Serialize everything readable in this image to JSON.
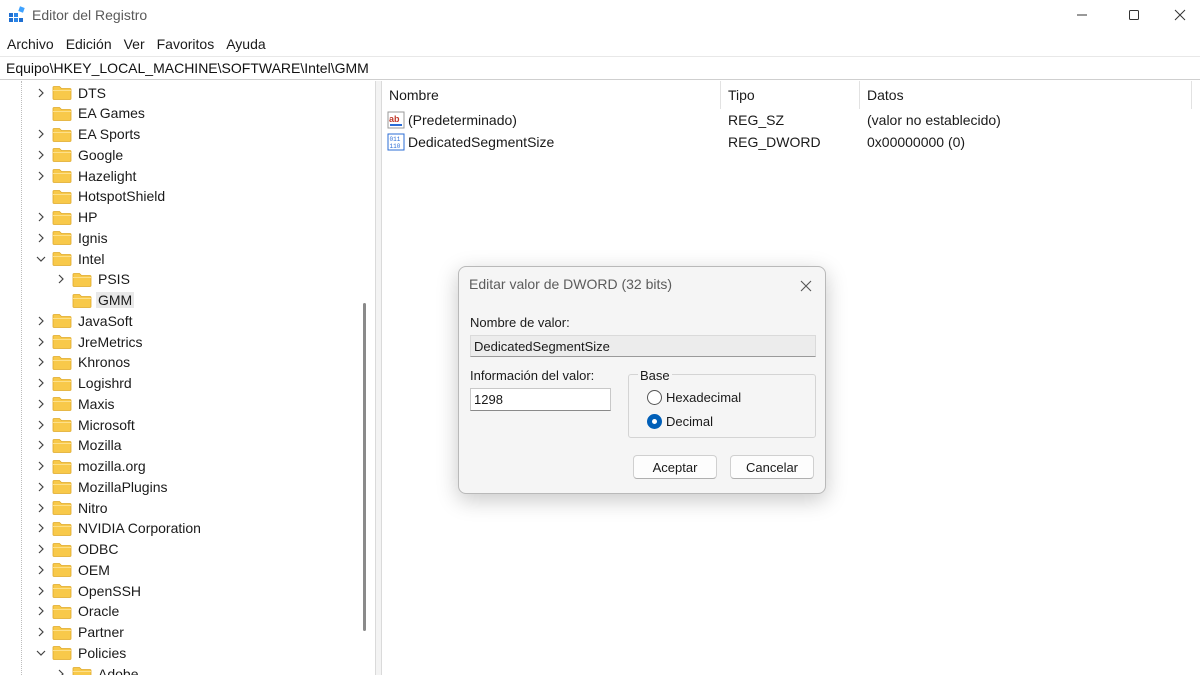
{
  "window": {
    "title": "Editor del Registro"
  },
  "menu": [
    "Archivo",
    "Edición",
    "Ver",
    "Favoritos",
    "Ayuda"
  ],
  "address": "Equipo\\HKEY_LOCAL_MACHINE\\SOFTWARE\\Intel\\GMM",
  "tree": {
    "items": [
      {
        "label": "DTS",
        "level": 0,
        "expander": "collapsed"
      },
      {
        "label": "EA Games",
        "level": 0,
        "expander": "none"
      },
      {
        "label": "EA Sports",
        "level": 0,
        "expander": "collapsed"
      },
      {
        "label": "Google",
        "level": 0,
        "expander": "collapsed"
      },
      {
        "label": "Hazelight",
        "level": 0,
        "expander": "collapsed"
      },
      {
        "label": "HotspotShield",
        "level": 0,
        "expander": "none"
      },
      {
        "label": "HP",
        "level": 0,
        "expander": "collapsed"
      },
      {
        "label": "Ignis",
        "level": 0,
        "expander": "collapsed"
      },
      {
        "label": "Intel",
        "level": 0,
        "expander": "expanded"
      },
      {
        "label": "PSIS",
        "level": 1,
        "expander": "collapsed"
      },
      {
        "label": "GMM",
        "level": 1,
        "expander": "none",
        "selected": true
      },
      {
        "label": "JavaSoft",
        "level": 0,
        "expander": "collapsed"
      },
      {
        "label": "JreMetrics",
        "level": 0,
        "expander": "collapsed"
      },
      {
        "label": "Khronos",
        "level": 0,
        "expander": "collapsed"
      },
      {
        "label": "Logishrd",
        "level": 0,
        "expander": "collapsed"
      },
      {
        "label": "Maxis",
        "level": 0,
        "expander": "collapsed"
      },
      {
        "label": "Microsoft",
        "level": 0,
        "expander": "collapsed"
      },
      {
        "label": "Mozilla",
        "level": 0,
        "expander": "collapsed"
      },
      {
        "label": "mozilla.org",
        "level": 0,
        "expander": "collapsed"
      },
      {
        "label": "MozillaPlugins",
        "level": 0,
        "expander": "collapsed"
      },
      {
        "label": "Nitro",
        "level": 0,
        "expander": "collapsed"
      },
      {
        "label": "NVIDIA Corporation",
        "level": 0,
        "expander": "collapsed"
      },
      {
        "label": "ODBC",
        "level": 0,
        "expander": "collapsed"
      },
      {
        "label": "OEM",
        "level": 0,
        "expander": "collapsed"
      },
      {
        "label": "OpenSSH",
        "level": 0,
        "expander": "collapsed"
      },
      {
        "label": "Oracle",
        "level": 0,
        "expander": "collapsed"
      },
      {
        "label": "Partner",
        "level": 0,
        "expander": "collapsed"
      },
      {
        "label": "Policies",
        "level": 0,
        "expander": "expanded"
      },
      {
        "label": "Adobe",
        "level": 1,
        "expander": "collapsed"
      }
    ]
  },
  "list": {
    "columns": [
      "Nombre",
      "Tipo",
      "Datos"
    ],
    "rows": [
      {
        "icon": "string-value-icon",
        "name": "(Predeterminado)",
        "type": "REG_SZ",
        "data": "(valor no establecido)"
      },
      {
        "icon": "dword-value-icon",
        "name": "DedicatedSegmentSize",
        "type": "REG_DWORD",
        "data": "0x00000000 (0)"
      }
    ]
  },
  "dialog": {
    "title": "Editar valor de DWORD (32 bits)",
    "name_label": "Nombre de valor:",
    "name_value": "DedicatedSegmentSize",
    "value_label": "Información del valor:",
    "value_data": "1298",
    "base_label": "Base",
    "base_options": [
      {
        "label": "Hexadecimal",
        "checked": false
      },
      {
        "label": "Decimal",
        "checked": true
      }
    ],
    "ok_label": "Aceptar",
    "cancel_label": "Cancelar"
  },
  "colors": {
    "folder": "#f8c94a",
    "accent": "#005fb8",
    "selection": "#e8e8e8"
  }
}
